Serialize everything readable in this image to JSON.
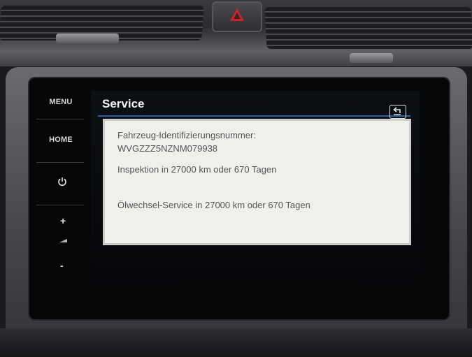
{
  "screen": {
    "title": "Service",
    "side_buttons": {
      "menu": "MENU",
      "home": "HOME",
      "volume_up": "+",
      "volume_down": "-"
    },
    "service_info": {
      "vin_label": "Fahrzeug-Identifizierungsnummer:",
      "vin_value": "WVGZZZ5NZNM079938",
      "inspection": "Inspektion in 27000 km oder 670 Tagen",
      "oil_service": "Ölwechsel-Service in 27000 km oder 670 Tagen"
    },
    "icons": [
      "power-icon",
      "speaker-icon",
      "back-icon",
      "hazard-icon"
    ],
    "colors": {
      "accent": "#2e5fa8",
      "panel_bg": "#f1efec",
      "hazard": "#d32025"
    }
  }
}
